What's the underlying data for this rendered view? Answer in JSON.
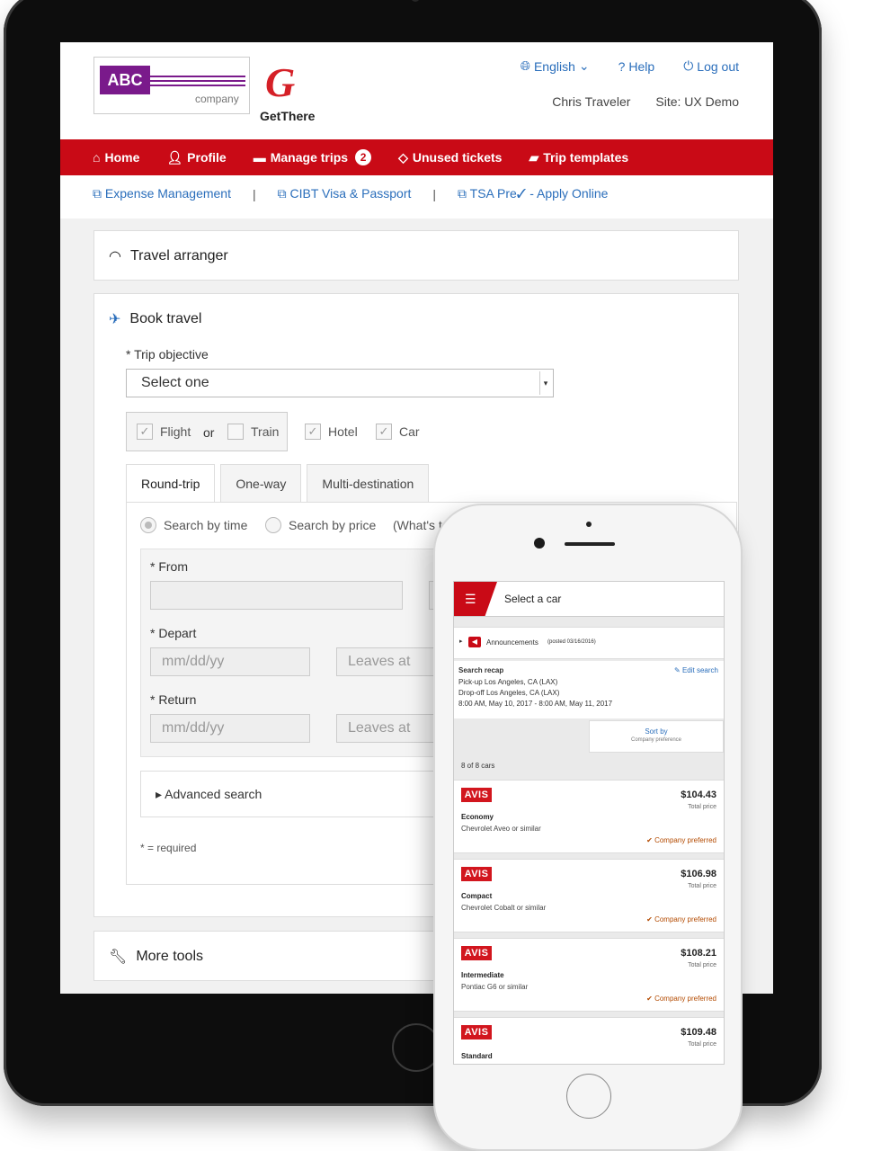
{
  "header": {
    "logo_abc": "ABC",
    "logo_company": "company",
    "logo_gethere": "GetThere",
    "language": "English",
    "help": "Help",
    "logout": "Log out",
    "user": "Chris Traveler",
    "site": "Site: UX Demo"
  },
  "nav": {
    "home": "Home",
    "profile": "Profile",
    "manage_trips": "Manage trips",
    "manage_trips_count": "2",
    "unused_tickets": "Unused tickets",
    "trip_templates": "Trip templates"
  },
  "sublinks": {
    "expense": "Expense Management",
    "cibt": "CIBT Visa & Passport",
    "tsa": "TSA Pre✓ - Apply Online",
    "separator": "|"
  },
  "travel_arranger": {
    "title": "Travel arranger"
  },
  "book_travel": {
    "title": "Book travel",
    "trip_objective_label": "* Trip objective",
    "trip_objective_value": "Select one",
    "flight": "Flight",
    "or": "or",
    "train": "Train",
    "hotel": "Hotel",
    "car": "Car",
    "tabs": [
      "Round-trip",
      "One-way",
      "Multi-destination"
    ],
    "search_by_time": "Search by time",
    "search_by_price": "Search by price",
    "whats": "(What's t",
    "from_label": "* From",
    "depart_label": "* Depart",
    "return_label": "* Return",
    "date_placeholder": "mm/dd/yy",
    "leaves_at": "Leaves at",
    "advanced_search": "Advanced search",
    "required_note": "* = required"
  },
  "more_tools": {
    "title": "More tools"
  },
  "phone": {
    "title": "Select a car",
    "announcements": "Announcements",
    "announcements_posted": "(posted 03/16/2016)",
    "search_recap": "Search recap",
    "edit_search": "Edit search",
    "pickup": "Pick-up Los Angeles, CA (LAX)",
    "dropoff": "Drop-off Los Angeles, CA (LAX)",
    "dates": "8:00 AM, May 10, 2017 - 8:00 AM, May 11, 2017",
    "sort_by": "Sort by",
    "sort_value": "Company preference",
    "count": "8 of 8 cars",
    "total_price": "Total price",
    "company_preferred": "Company preferred",
    "cars": [
      {
        "vendor": "AVIS",
        "class": "Economy",
        "model": "Chevrolet Aveo or similar",
        "price": "$104.43"
      },
      {
        "vendor": "AVIS",
        "class": "Compact",
        "model": "Chevrolet Cobalt or similar",
        "price": "$106.98"
      },
      {
        "vendor": "AVIS",
        "class": "Intermediate",
        "model": "Pontiac G6 or similar",
        "price": "$108.21"
      },
      {
        "vendor": "AVIS",
        "class": "Standard",
        "model": "",
        "price": "$109.48"
      }
    ]
  }
}
